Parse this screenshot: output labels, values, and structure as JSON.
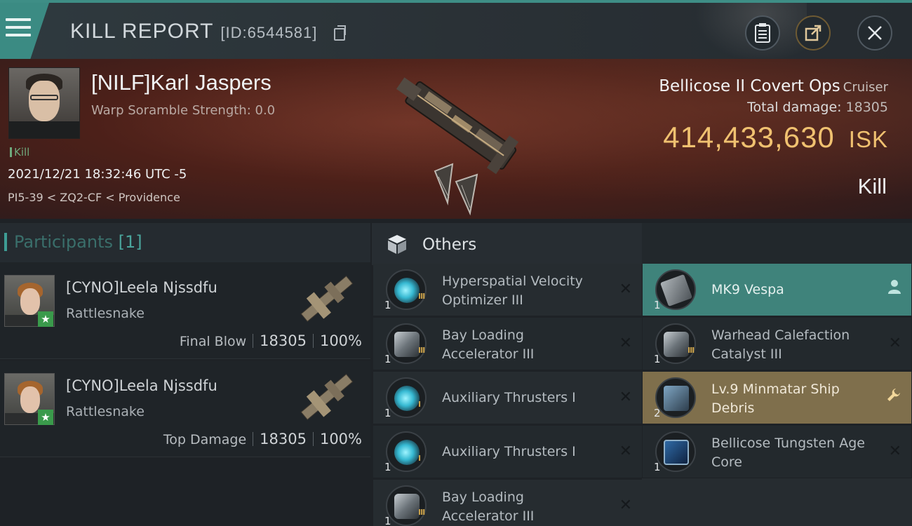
{
  "header": {
    "title": "KILL REPORT",
    "report_id": "[ID:6544581]"
  },
  "victim": {
    "name": "[NILF]Karl Jaspers",
    "warp_scramble": "Warp Soramble Strength: 0.0",
    "kill_tag": "Kill",
    "datetime": "2021/12/21 18:32:46 UTC -5",
    "location": "PI5-39 < ZQ2-CF < Providence",
    "ship_name": "Bellicose II Covert Ops",
    "ship_class": "Cruiser",
    "total_damage_label": "Total damage:",
    "total_damage": "18305",
    "isk_value": "414,433,630",
    "isk_unit": "ISK",
    "result": "Kill"
  },
  "participants": {
    "label": "Participants",
    "count": "[1]",
    "items": [
      {
        "name": "[CYNO]Leela Njssdfu",
        "ship": "Rattlesnake",
        "stat_label": "Final Blow",
        "damage": "18305",
        "percent": "100%"
      },
      {
        "name": "[CYNO]Leela Njssdfu",
        "ship": "Rattlesnake",
        "stat_label": "Top Damage",
        "damage": "18305",
        "percent": "100%"
      }
    ]
  },
  "others": {
    "label": "Others",
    "left_items": [
      {
        "qty": "1",
        "name": "Hyperspatial Velocity Optimizer III",
        "tier": "III",
        "icon": "cyan-sphere-icon"
      },
      {
        "qty": "1",
        "name": "Bay Loading Accelerator III",
        "tier": "III",
        "icon": "metal-module-icon"
      },
      {
        "qty": "1",
        "name": "Auxiliary Thrusters I",
        "tier": "I",
        "icon": "cyan-sphere-icon"
      },
      {
        "qty": "1",
        "name": "Auxiliary Thrusters I",
        "tier": "I",
        "icon": "cyan-sphere-icon"
      },
      {
        "qty": "1",
        "name": "Bay Loading Accelerator III",
        "tier": "III",
        "icon": "metal-module-icon"
      }
    ],
    "right_items": [
      {
        "qty": "1",
        "name": "MK9 Vespa",
        "icon": "drone-icon"
      },
      {
        "qty": "1",
        "name": "Warhead Calefaction Catalyst III",
        "tier": "III",
        "icon": "metal-module-icon"
      },
      {
        "qty": "2",
        "name": "Lv.9 Minmatar Ship Debris",
        "icon": "debris-icon"
      },
      {
        "qty": "1",
        "name": "Bellicose Tungsten Age Core",
        "icon": "core-icon"
      }
    ]
  },
  "colors": {
    "accent_teal": "#3e8e86",
    "isk_gold": "#f0c170",
    "highlight_teal": "#3f837b",
    "highlight_gold": "#7f6f4c"
  }
}
